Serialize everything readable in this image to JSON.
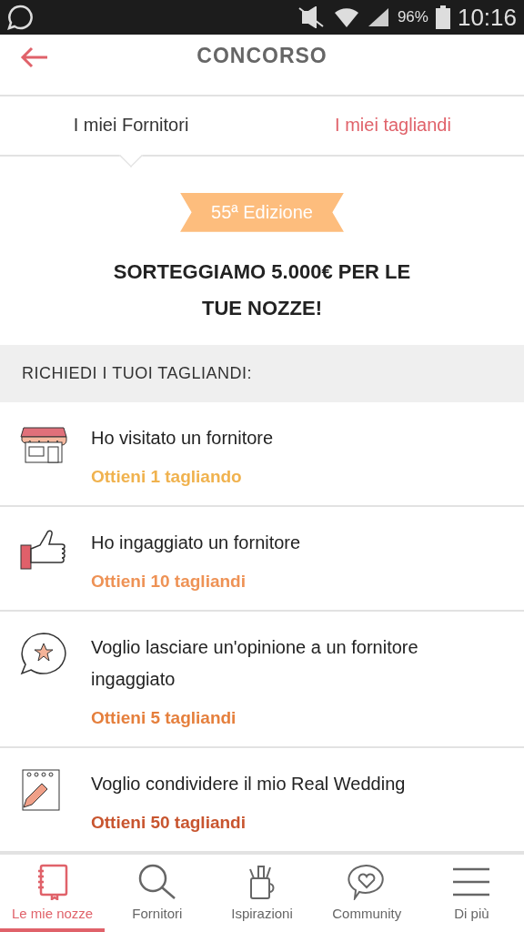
{
  "status_bar": {
    "battery": "96%",
    "time": "10:16"
  },
  "header": {
    "title": "CONCORSO"
  },
  "tabs": [
    {
      "label": "I miei Fornitori",
      "selected": false
    },
    {
      "label": "I miei tagliandi",
      "selected": true
    }
  ],
  "hero": {
    "badge": "55ª Edizione",
    "title": "SORTEGGIAMO 5.000€ PER LE TUE NOZZE!"
  },
  "section": {
    "title": "RICHIEDI I TUOI TAGLIANDI:"
  },
  "items": [
    {
      "kind": "shop",
      "text": "Ho visitato un fornitore",
      "reward": "Ottieni 1 tagliando",
      "color": "#f0b24e"
    },
    {
      "kind": "thumb",
      "text": "Ho ingaggiato un fornitore",
      "reward": "Ottieni 10 tagliandi",
      "color": "#ee9255"
    },
    {
      "kind": "review",
      "text": "Voglio lasciare un'opinione a un fornitore ingaggiato",
      "reward": "Ottieni 5 tagliandi",
      "color": "#e57f3c"
    },
    {
      "kind": "notebook",
      "text": "Voglio condividere il mio Real Wedding",
      "reward": "Ottieni 50 tagliandi",
      "color": "#c8552f"
    }
  ],
  "nav": [
    {
      "kind": "notebook",
      "label": "Le mie nozze",
      "selected": true
    },
    {
      "kind": "search",
      "label": "Fornitori",
      "selected": false
    },
    {
      "kind": "cup",
      "label": "Ispirazioni",
      "selected": false
    },
    {
      "kind": "chat",
      "label": "Community",
      "selected": false
    },
    {
      "kind": "menu",
      "label": "Di più",
      "selected": false
    }
  ]
}
